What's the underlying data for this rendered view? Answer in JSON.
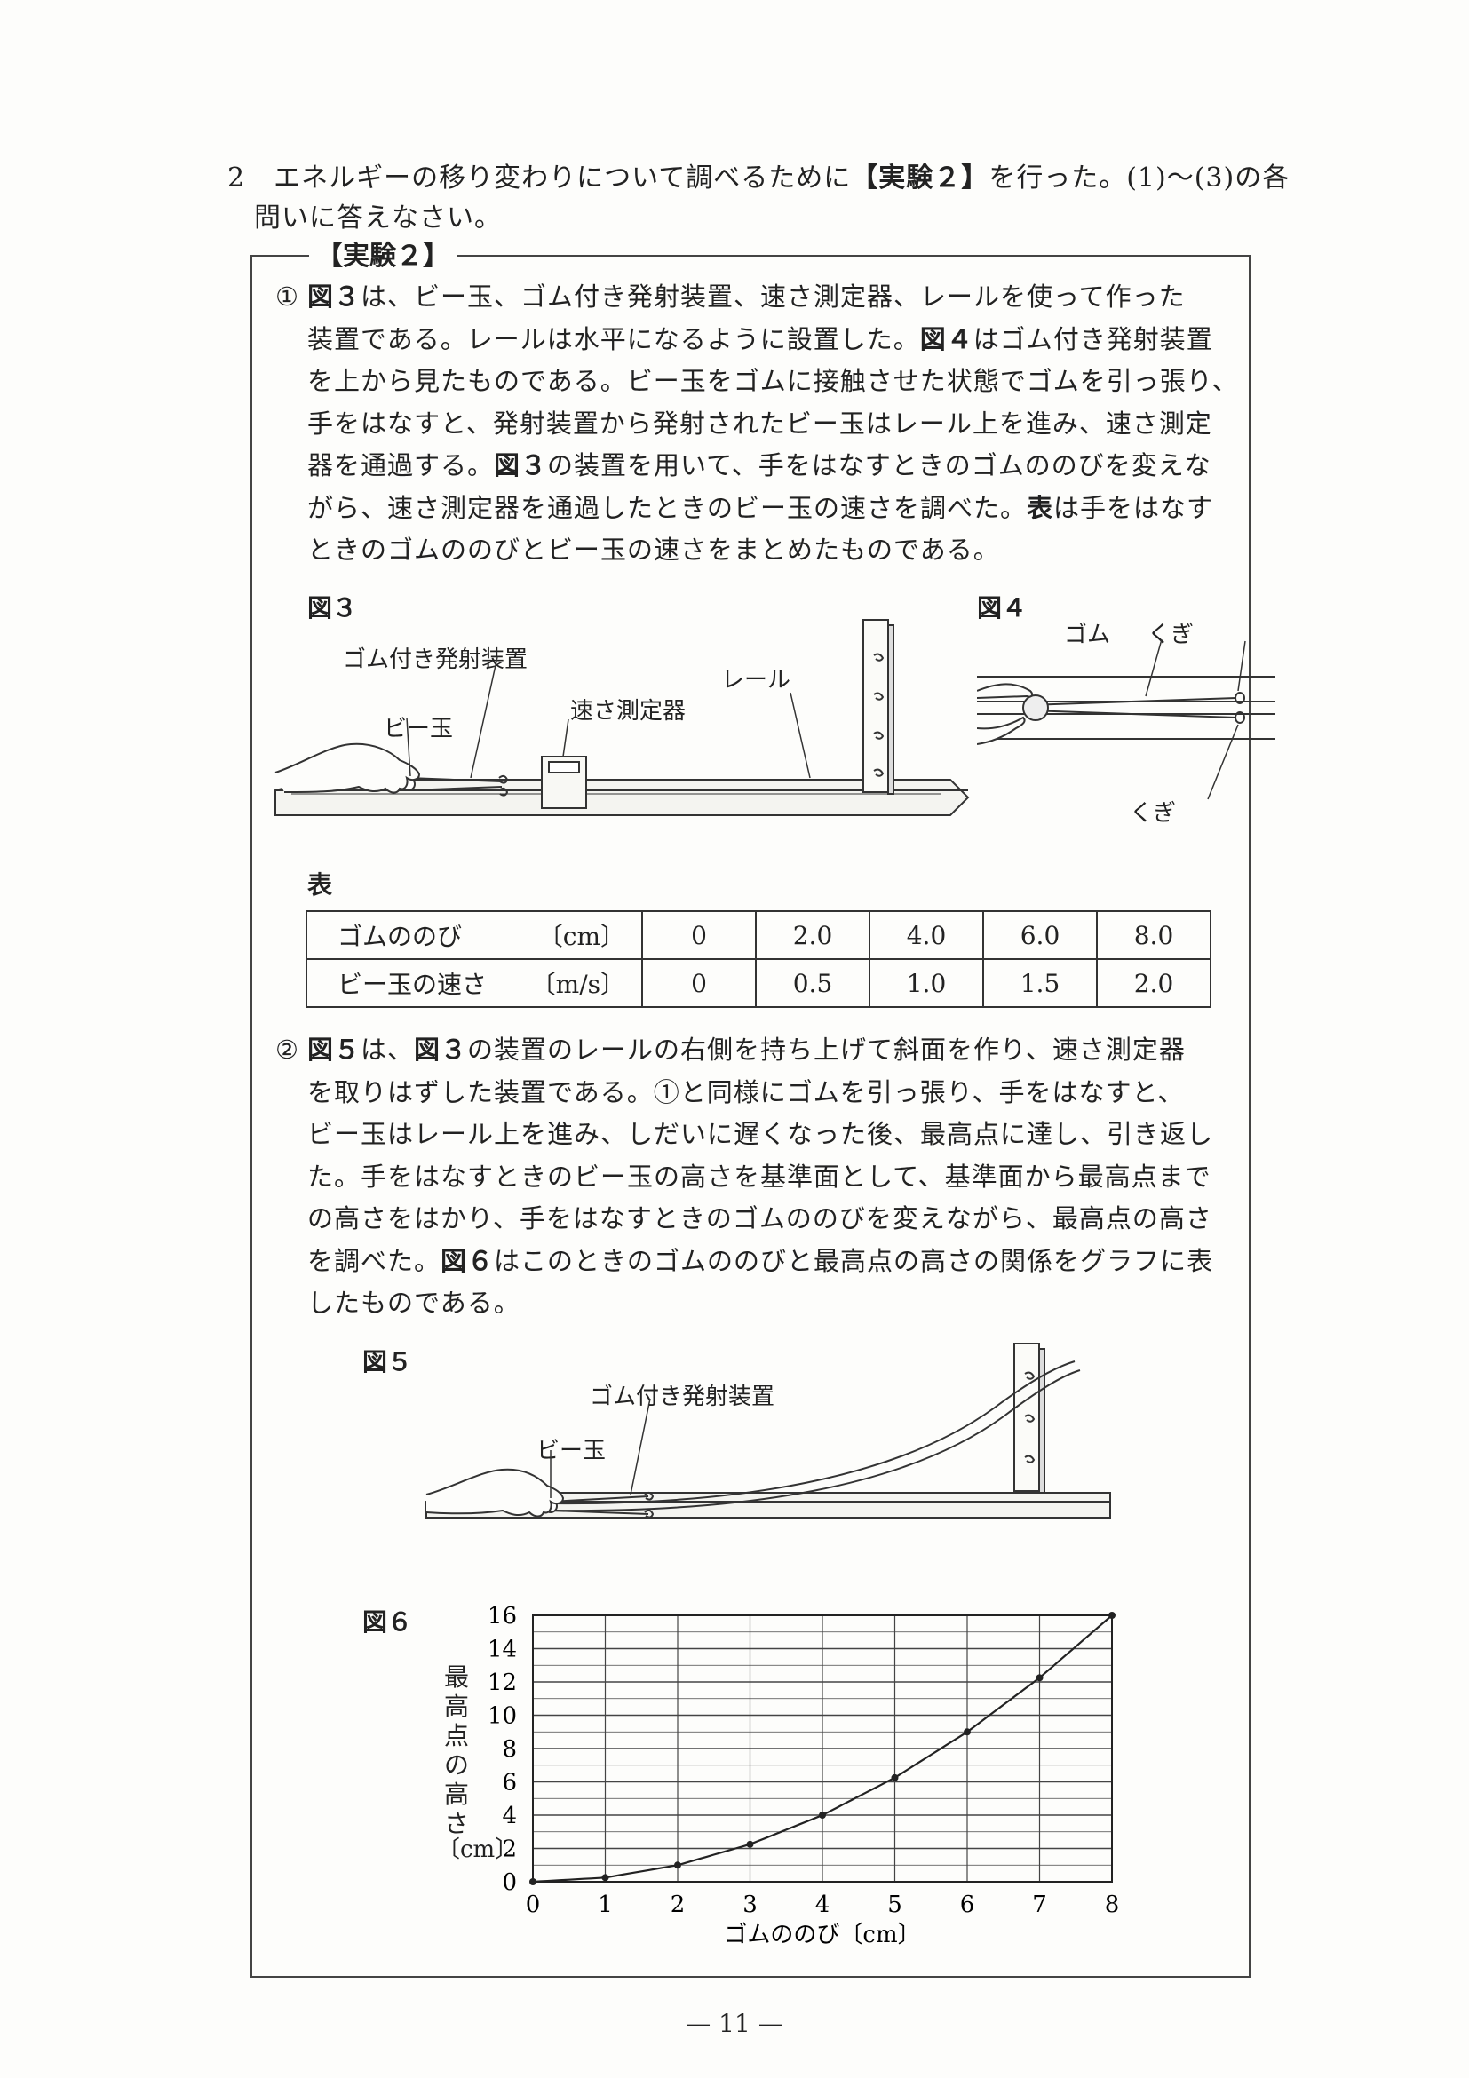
{
  "question": {
    "number": "2",
    "line1_pre": "エネルギーの移り変わりについて調べるために",
    "line1_bold": "【実験２】",
    "line1_post": "を行った。(1)〜(3)の各",
    "line2": "問いに答えなさい。"
  },
  "box_title": "【実験２】",
  "step1": {
    "marker": "①",
    "lines": [
      [
        "",
        "図３",
        "は、ビー玉、ゴム付き発射装置、速さ測定器、レールを使って作った"
      ],
      [
        "装置である。レールは水平になるように設置した。",
        "図４",
        "はゴム付き発射装置"
      ],
      [
        "を上から見たものである。ビー玉をゴムに接触させた状態でゴムを引っ張り、",
        "",
        ""
      ],
      [
        "手をはなすと、発射装置から発射されたビー玉はレール上を進み、速さ測定",
        "",
        ""
      ],
      [
        "器を通過する。",
        "図３",
        "の装置を用いて、手をはなすときのゴムののびを変えな"
      ],
      [
        "がら、速さ測定器を通過したときのビー玉の速さを調べた。",
        "表",
        "は手をはなす"
      ],
      [
        "ときのゴムののびとビー玉の速さをまとめたものである。",
        "",
        ""
      ]
    ]
  },
  "figure3": {
    "label": "図３",
    "labels": {
      "launcher": "ゴム付き発射装置",
      "marble": "ビー玉",
      "speed_meter": "速さ測定器",
      "rail": "レール"
    }
  },
  "figure4": {
    "label": "図４",
    "labels": {
      "rubber": "ゴム",
      "nail_top": "くぎ",
      "nail_bottom": "くぎ"
    }
  },
  "table": {
    "label": "表",
    "rows": [
      {
        "header": "ゴムののび",
        "unit": "〔cm〕",
        "values": [
          "0",
          "2.0",
          "4.0",
          "6.0",
          "8.0"
        ]
      },
      {
        "header": "ビー玉の速さ",
        "unit": "〔m/s〕",
        "values": [
          "0",
          "0.5",
          "1.0",
          "1.5",
          "2.0"
        ]
      }
    ]
  },
  "step2": {
    "marker": "②",
    "lines": [
      [
        "",
        "図５",
        "は、",
        "図３",
        "の装置のレールの右側を持ち上げて斜面を作り、速さ測定器"
      ],
      [
        "を取りはずした装置である。①と同様にゴムを引っ張り、手をはなすと、",
        "",
        "",
        "",
        ""
      ],
      [
        "ビー玉はレール上を進み、しだいに遅くなった後、最高点に達し、引き返し",
        "",
        "",
        "",
        ""
      ],
      [
        "た。手をはなすときのビー玉の高さを基準面として、基準面から最高点まで",
        "",
        "",
        "",
        ""
      ],
      [
        "の高さをはかり、手をはなすときのゴムののびを変えながら、最高点の高さ",
        "",
        "",
        "",
        ""
      ],
      [
        "を調べた。",
        "図６",
        "はこのときのゴムののびと最高点の高さの関係をグラフに表",
        "",
        ""
      ],
      [
        "したものである。",
        "",
        "",
        "",
        ""
      ]
    ]
  },
  "figure5": {
    "label": "図５",
    "labels": {
      "launcher": "ゴム付き発射装置",
      "marble": "ビー玉"
    }
  },
  "chart_data": {
    "type": "line",
    "label": "図６",
    "xlabel": "ゴムののび〔cm〕",
    "ylabel_chars": [
      "最",
      "高",
      "点",
      "の",
      "高",
      "さ"
    ],
    "ylabel_unit": "〔cm〕",
    "x_ticks": [
      0,
      1,
      2,
      3,
      4,
      5,
      6,
      7,
      8
    ],
    "y_ticks": [
      0,
      2,
      4,
      6,
      8,
      10,
      12,
      14,
      16
    ],
    "xlim": [
      0,
      8
    ],
    "ylim": [
      0,
      16
    ],
    "grid": true,
    "series": [
      {
        "x": [
          0,
          1,
          2,
          3,
          4,
          5,
          6,
          7,
          8
        ],
        "y": [
          0,
          0.25,
          1.0,
          2.25,
          4.0,
          6.25,
          9.0,
          12.25,
          16.0
        ]
      }
    ]
  },
  "page_number": "— 11 —"
}
